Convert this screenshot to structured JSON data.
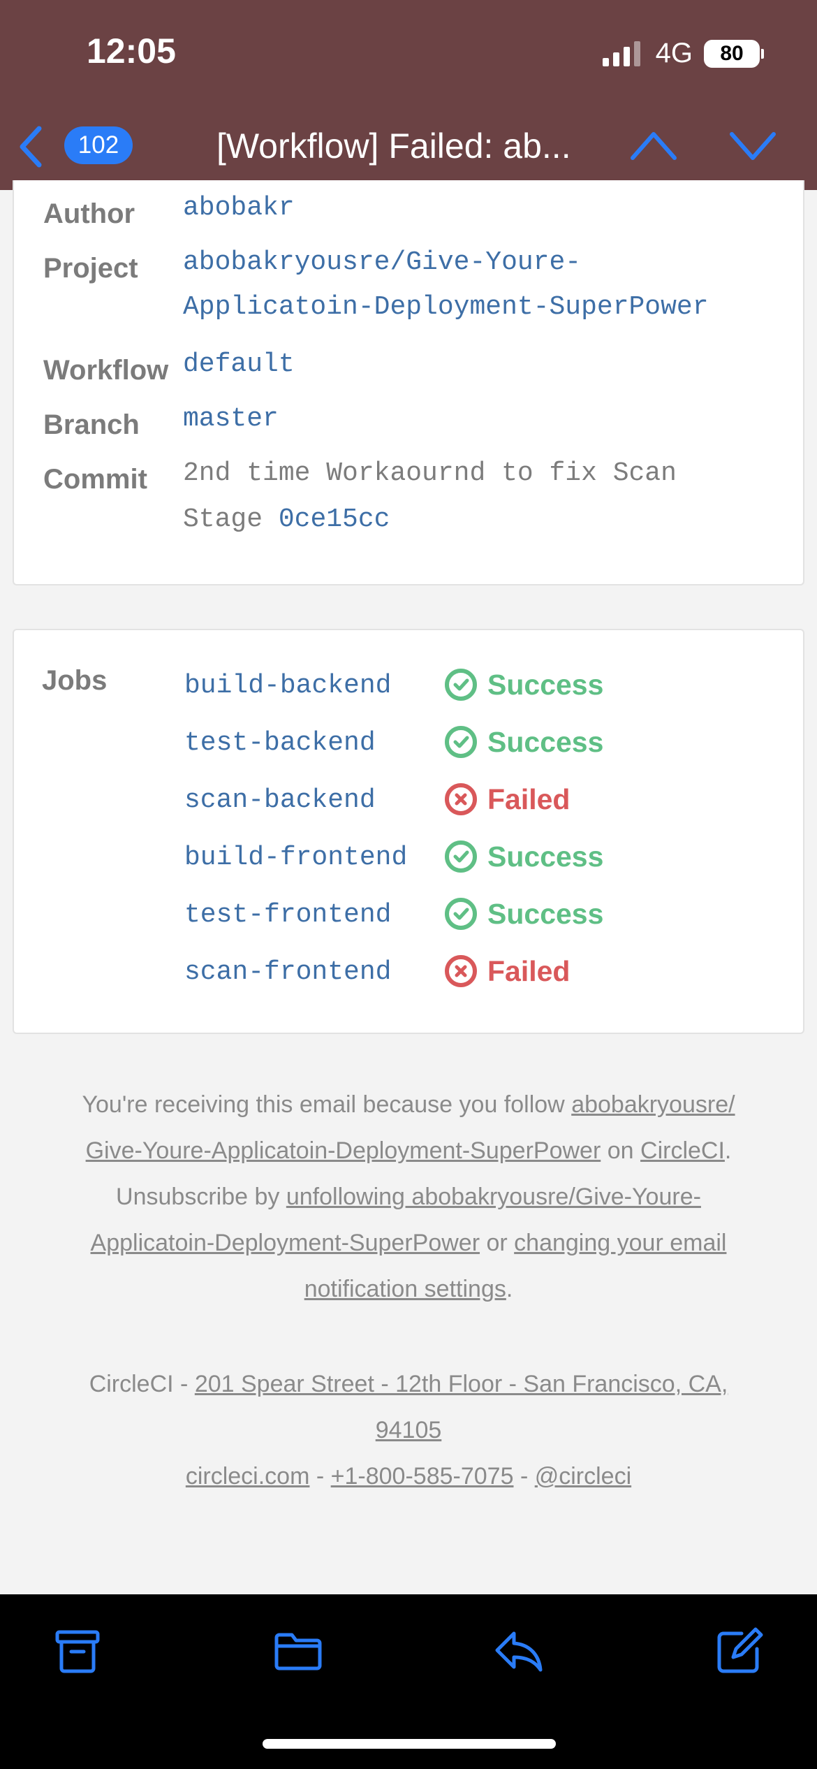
{
  "status_bar": {
    "time": "12:05",
    "network": "4G",
    "battery": "80"
  },
  "nav": {
    "unread_count": "102",
    "title": "[Workflow] Failed: ab..."
  },
  "details": {
    "author_label": "Author",
    "author": "abobakr",
    "project_label": "Project",
    "project_line1": "abobakryousre/Give-Youre-",
    "project_line2": "Applicatoin-Deployment-SuperPower",
    "workflow_label": "Workflow",
    "workflow": "default",
    "branch_label": "Branch",
    "branch": "master",
    "commit_label": "Commit",
    "commit_message_line1": "2nd time Workaournd to fix Scan",
    "commit_message_line2": "Stage",
    "commit_hash": "0ce15cc"
  },
  "jobs": {
    "label": "Jobs",
    "items": [
      {
        "name": "build-backend",
        "status": "Success"
      },
      {
        "name": "test-backend",
        "status": "Success"
      },
      {
        "name": "scan-backend",
        "status": "Failed"
      },
      {
        "name": "build-frontend",
        "status": "Success"
      },
      {
        "name": "test-frontend",
        "status": "Success"
      },
      {
        "name": "scan-frontend",
        "status": "Failed"
      }
    ]
  },
  "footer": {
    "receiving_prefix": "You're receiving this email because you follow",
    "follow_link_line1": "abobakryousre/",
    "follow_link_line2": "Give-Youre-Applicatoin-Deployment-SuperPower",
    "on_text": "on",
    "circleci_link": "CircleCI",
    "period": ".",
    "unsubscribe_prefix": "Unsubscribe by",
    "unfollow_link_line1": "unfollowing abobakryousre/Give-Youre-",
    "unfollow_link_line2": "Applicatoin-Deployment-SuperPower",
    "or_text": "or",
    "settings_link_line1": "changing your email",
    "settings_link_line2": "notification settings",
    "company_prefix": "CircleCI -",
    "address_line1": "201 Spear Street - 12th Floor - San Francisco, CA,",
    "address_line2": "94105",
    "site_link": "circleci.com",
    "phone_link": "+1-800-585-7075",
    "twitter_link": "@circleci",
    "separator": "-"
  },
  "toolbar": {
    "icons": [
      "archive-icon",
      "folder-icon",
      "reply-icon",
      "compose-icon"
    ]
  },
  "colors": {
    "header_bg": "#6b4244",
    "accent_blue": "#2a7cf7",
    "success": "#5fbf85",
    "failed": "#d9585a",
    "link_mono": "#3d6ea6"
  }
}
